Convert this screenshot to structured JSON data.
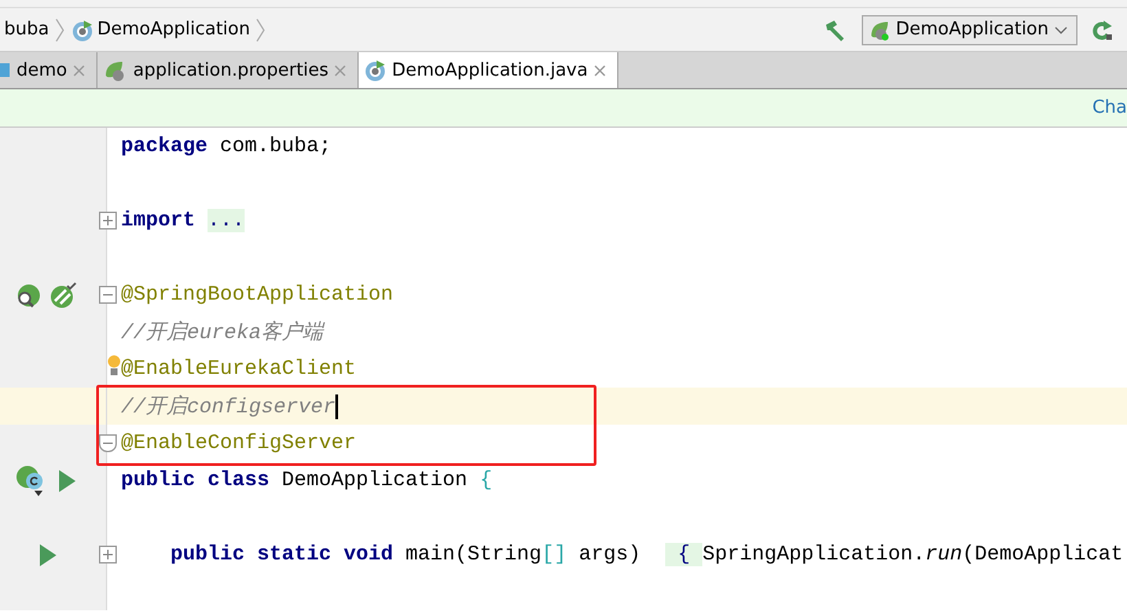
{
  "breadcrumb": {
    "items": [
      {
        "label": "buba",
        "icon": false
      },
      {
        "label": "DemoApplication",
        "icon": true
      }
    ]
  },
  "toolbar": {
    "run_config": "DemoApplication"
  },
  "tabs": [
    {
      "label": "demo",
      "kind": "module",
      "selected": false
    },
    {
      "label": "application.properties",
      "kind": "spring",
      "selected": false
    },
    {
      "label": "DemoApplication.java",
      "kind": "class",
      "selected": true
    }
  ],
  "notification": {
    "link": "Cha"
  },
  "editor": {
    "lines": [
      {
        "kind": "code",
        "tokens": [
          {
            "t": "package",
            "kind": "keyword"
          },
          {
            "t": " com.buba;",
            "kind": "plain"
          }
        ]
      },
      {
        "kind": "blank"
      },
      {
        "kind": "code",
        "fold": {
          "kind": "expand"
        },
        "tokens": [
          {
            "t": "import",
            "kind": "keyword"
          },
          {
            "t": "...",
            "kind": "folded"
          }
        ]
      },
      {
        "kind": "blank"
      },
      {
        "kind": "code",
        "fold": {
          "kind": "collapse"
        },
        "gutter": [
          {
            "kind": "spring-search"
          },
          {
            "kind": "spring-check"
          }
        ],
        "tokens": [
          {
            "t": "@SpringBootApplication",
            "kind": "annotation"
          }
        ]
      },
      {
        "kind": "code",
        "tokens": [
          {
            "t": "//开启eureka客户端",
            "kind": "comment"
          }
        ]
      },
      {
        "kind": "code",
        "bulb": true,
        "tokens": [
          {
            "t": "@EnableEurekaClient",
            "kind": "annotation"
          }
        ]
      },
      {
        "kind": "code",
        "current": true,
        "caret": true,
        "framed": true,
        "tokens": [
          {
            "t": "//开启configserver",
            "kind": "comment"
          }
        ]
      },
      {
        "kind": "code",
        "framed": true,
        "fold": {
          "kind": "end"
        },
        "tokens": [
          {
            "t": "@EnableConfigServer",
            "kind": "annotation"
          }
        ]
      },
      {
        "kind": "code",
        "gutter": [
          {
            "kind": "class-bean"
          },
          {
            "kind": "run"
          }
        ],
        "tokens": [
          {
            "t": "public class",
            "kind": "keyword"
          },
          {
            "t": " DemoApplication ",
            "kind": "plain"
          },
          {
            "t": "{",
            "kind": "brace"
          }
        ],
        "children": [
          {
            "kind": "blank"
          },
          {
            "kind": "code",
            "fold": {
              "kind": "expand"
            },
            "gutter": [
              {
                "kind": "run"
              }
            ],
            "tokens": [
              {
                "t": "public static void",
                "kind": "keyword"
              },
              {
                "t": " main(String",
                "kind": "plain"
              },
              {
                "t": "[]",
                "kind": "brace"
              },
              {
                "t": " args) ",
                "kind": "plain"
              },
              {
                "t": " { ",
                "kind": "folded"
              },
              {
                "t": "SpringApplication.",
                "kind": "plain"
              },
              {
                "t": "run",
                "kind": "static"
              },
              {
                "t": "(DemoApplicat",
                "kind": "plain"
              }
            ]
          },
          {
            "kind": "blank"
          }
        ]
      }
    ]
  }
}
